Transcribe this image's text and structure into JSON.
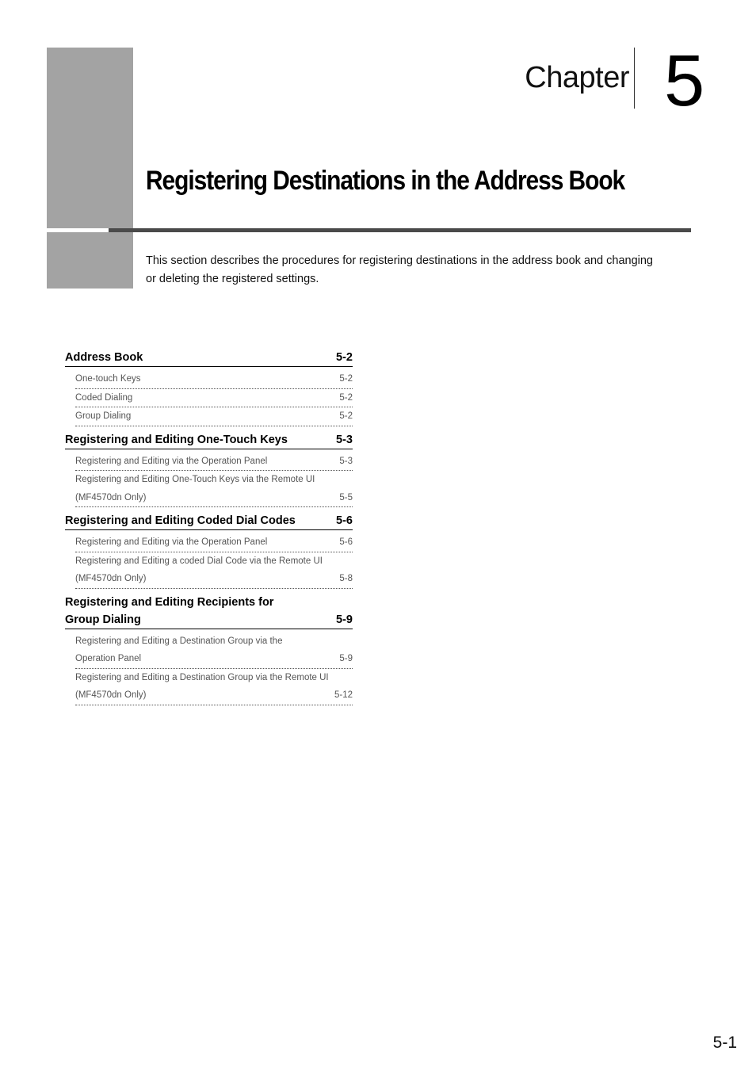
{
  "chapter": {
    "label": "Chapter",
    "number": "5",
    "title": "Registering Destinations in the Address Book",
    "intro": "This section describes the procedures for registering destinations in the address book and changing or deleting the registered settings."
  },
  "toc": [
    {
      "title": "Address Book",
      "page": "5-2",
      "items": [
        {
          "title": "One-touch Keys",
          "page": "5-2"
        },
        {
          "title": "Coded Dialing",
          "page": "5-2"
        },
        {
          "title": "Group Dialing",
          "page": "5-2"
        }
      ]
    },
    {
      "title": "Registering and Editing One-Touch Keys",
      "page": "5-3",
      "items": [
        {
          "title": "Registering and Editing via the Operation Panel",
          "page": "5-3"
        },
        {
          "title_line1": "Registering and Editing One-Touch Keys via the Remote UI",
          "title_line2": "(MF4570dn Only)",
          "page": "5-5"
        }
      ]
    },
    {
      "title": "Registering and Editing Coded Dial Codes",
      "page": "5-6",
      "items": [
        {
          "title": "Registering and Editing via the Operation Panel",
          "page": "5-6"
        },
        {
          "title_line1": "Registering and Editing a coded Dial Code via the Remote UI",
          "title_line2": "(MF4570dn Only)",
          "page": "5-8"
        }
      ]
    },
    {
      "title_line1": "Registering and Editing Recipients for",
      "title_line2": "Group Dialing",
      "page": "5-9",
      "items": [
        {
          "title_line1": "Registering and Editing a Destination Group via the",
          "title_line2": "Operation Panel",
          "page": "5-9"
        },
        {
          "title_line1": "Registering and Editing a Destination Group via the Remote UI",
          "title_line2": "(MF4570dn Only)",
          "page": "5-12"
        }
      ]
    }
  ],
  "footer": {
    "page_number": "5-1"
  }
}
